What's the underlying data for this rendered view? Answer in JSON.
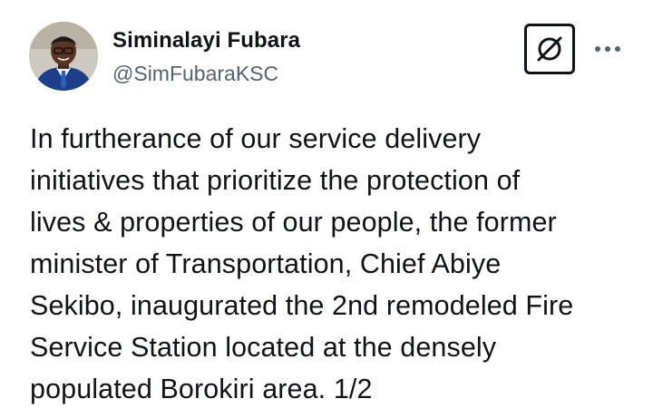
{
  "author": {
    "display_name": "Siminalayi Fubara",
    "handle": "@SimFubaraKSC",
    "avatar_icon": "profile-photo"
  },
  "actions": {
    "grok_icon": "grok-icon",
    "more_icon": "more-horizontal-icon"
  },
  "tweet": {
    "text": "In furtherance of our service delivery\ninitiatives that prioritize the protection of\nlives & properties of our people, the former\nminister of Transportation, Chief Abiye\nSekibo, inaugurated the 2nd remodeled Fire\nService Station located at the densely\npopulated Borokiri area. 1/2"
  },
  "colors": {
    "text_primary": "#0f1419",
    "text_secondary": "#536471",
    "background": "#ffffff"
  }
}
